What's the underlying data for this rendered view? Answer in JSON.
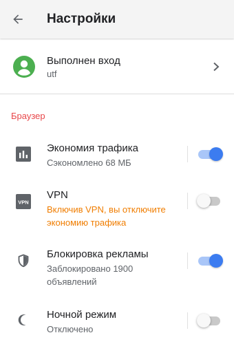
{
  "header": {
    "title": "Настройки",
    "back_icon": "arrow-left-icon"
  },
  "account": {
    "title": "Выполнен вход",
    "subtitle": "utf",
    "avatar_icon": "account-circle-icon",
    "avatar_color": "#4caf50"
  },
  "section": {
    "title": "Браузер",
    "color": "#e8474a"
  },
  "settings": [
    {
      "title": "Экономия трафика",
      "subtitle": "Сэкономлено 68 МБ",
      "icon": "data-saver-icon",
      "enabled": true
    },
    {
      "title": "VPN",
      "subtitle": "Включив VPN, вы отключите экономию трафика",
      "subtitle_color": "#f07d00",
      "icon": "vpn-icon",
      "icon_text": "VPN",
      "enabled": false
    },
    {
      "title": "Блокировка рекламы",
      "subtitle": "Заблокировано 1900 объявлений",
      "icon": "shield-icon",
      "enabled": true
    },
    {
      "title": "Ночной режим",
      "subtitle": "Отключено",
      "icon": "moon-icon",
      "enabled": false
    }
  ],
  "colors": {
    "toggle_on": "#3c7cf0",
    "toggle_track_on": "#a9c6f8",
    "toggle_off_track": "#c9c9c9"
  }
}
